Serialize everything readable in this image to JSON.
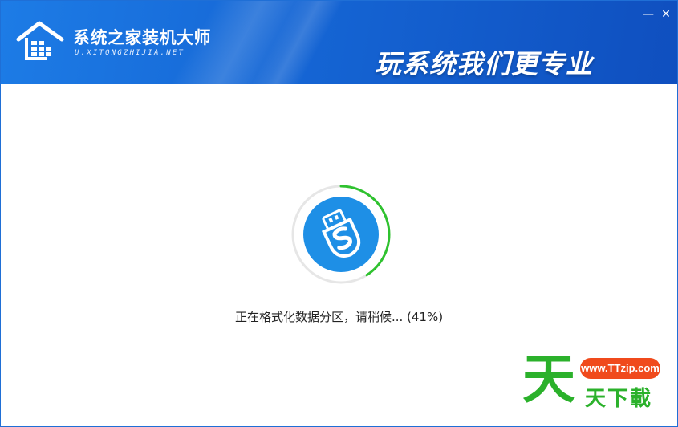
{
  "header": {
    "brand_title": "系统之家装机大师",
    "brand_subtitle": "U.XITONGZHIJIA.NET",
    "slogan": "玩系统我们更专业"
  },
  "window_controls": {
    "minimize_label": "—",
    "close_label": "✕"
  },
  "progress": {
    "status_text": "正在格式化数据分区，请稍候... (41%)",
    "percent": 41,
    "ring_color": "#2fc22f",
    "ring_track_color": "#e6e6e6",
    "icon_bg_color": "#1e8fe6"
  },
  "watermark": {
    "big_char": "天",
    "url": "www.TTzip.com",
    "text": "天下載"
  },
  "colors": {
    "header_blue": "#1565d4",
    "accent_green": "#2bb12b",
    "badge_orange": "#f04a1c"
  },
  "icons": [
    "house-logo-icon",
    "minimize-icon",
    "close-icon",
    "usb-s-icon"
  ]
}
